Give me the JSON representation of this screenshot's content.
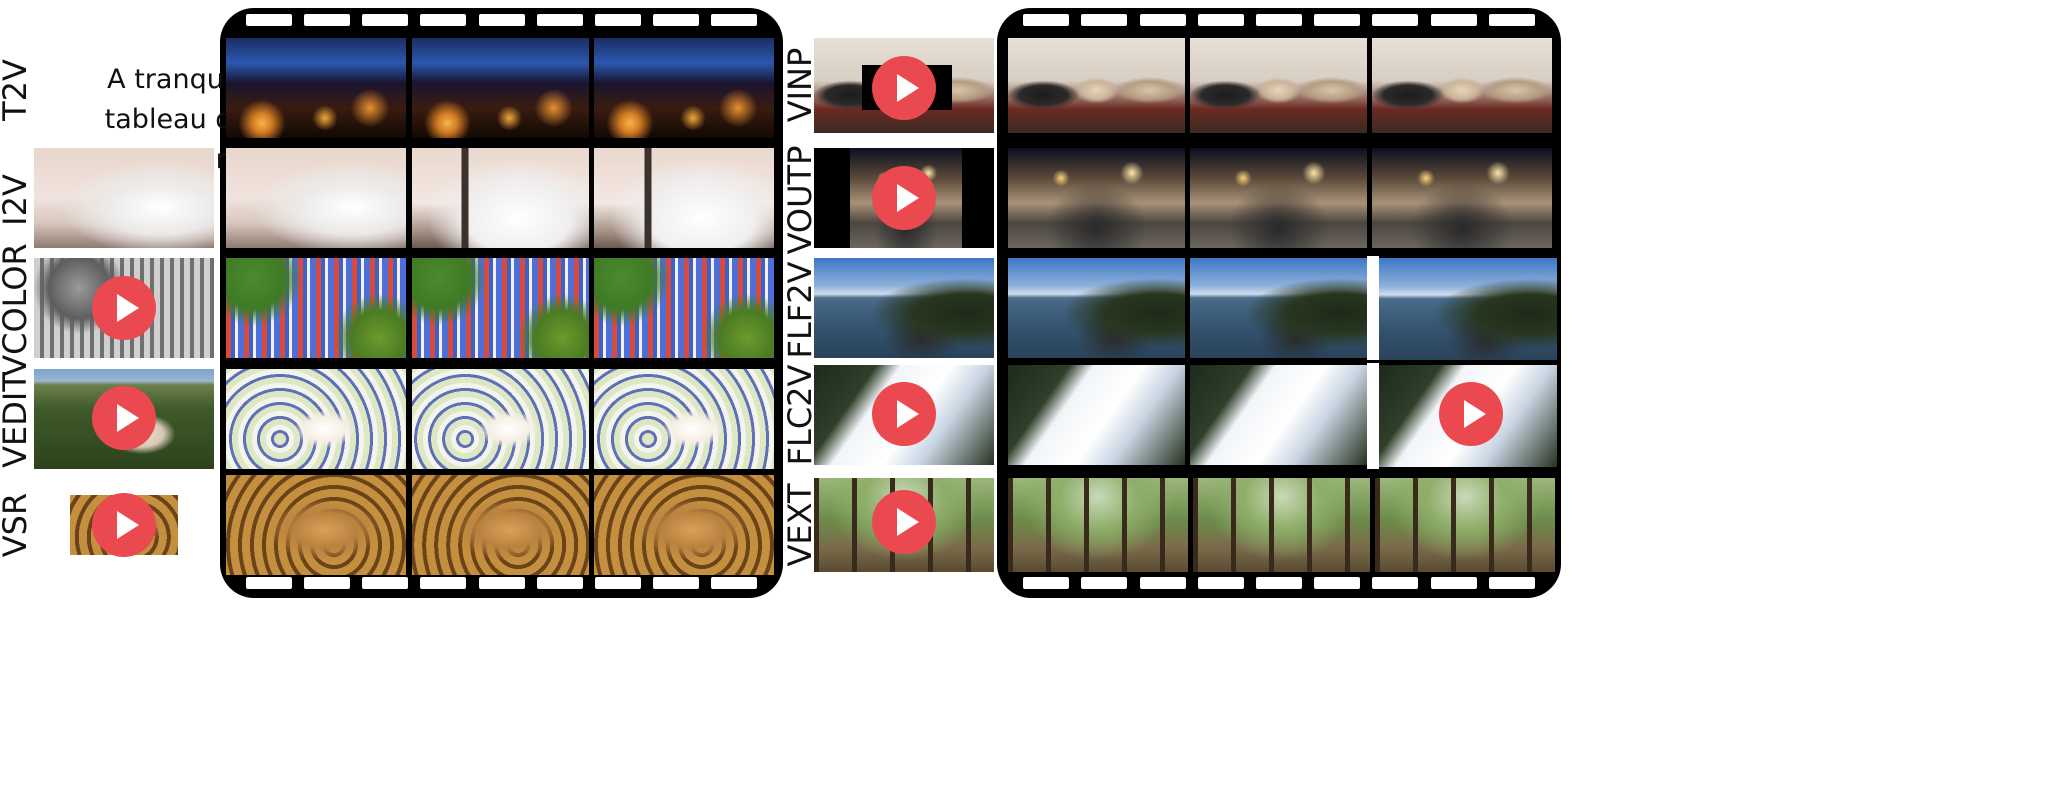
{
  "prompt_text": [
    "A tranquil",
    "tableau of",
    "restaurant"
  ],
  "left_tasks": [
    "T2V",
    "I2V",
    "VCOLOR",
    "VEDIT",
    "VSR"
  ],
  "right_tasks": [
    "VINP",
    "VOUTP",
    "FLF2V",
    "FLC2V",
    "VEXT"
  ],
  "colors": {
    "film": "#000000",
    "play_button": "#ea4a4f",
    "background": "#ffffff"
  },
  "icons": {
    "play": "play-icon"
  }
}
